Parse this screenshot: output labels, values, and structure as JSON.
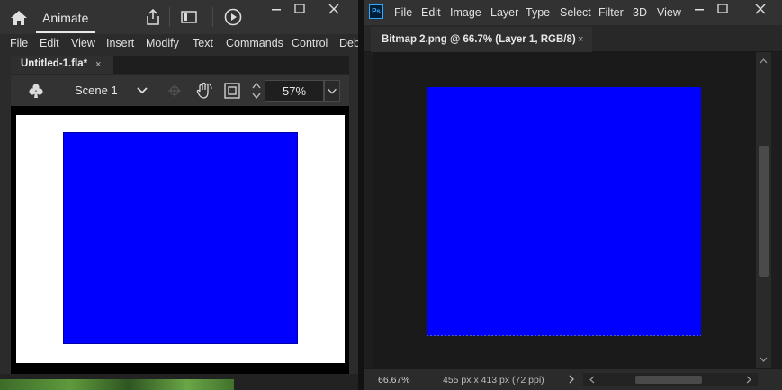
{
  "animate": {
    "app_title": "Animate",
    "icons": {
      "home": "home-icon",
      "share": "share-icon",
      "layout": "workspace-layout-icon",
      "play": "play-icon",
      "club": "club-icon",
      "chevron": "chevron-down-icon",
      "crosshair": "crosshair-icon",
      "hand": "hand-rotate-icon",
      "fit": "fit-frame-icon",
      "stepper": "stepper-icon"
    },
    "menu": [
      "File",
      "Edit",
      "View",
      "Insert",
      "Modify",
      "Text",
      "Commands",
      "Control",
      "Deb"
    ],
    "doc_tab": {
      "label": "Untitled-1.fla*",
      "close": "×"
    },
    "toolbar": {
      "scene_label": "Scene 1",
      "zoom_value": "57%"
    },
    "colors": {
      "stage_fill": "#0000FF",
      "rect_stroke": "#0000AA",
      "canvas": "#FFFFFF"
    }
  },
  "photoshop": {
    "logo": "Ps",
    "menu": [
      "File",
      "Edit",
      "Image",
      "Layer",
      "Type",
      "Select",
      "Filter",
      "3D",
      "View"
    ],
    "doc_tab": {
      "label": "Bitmap 2.png @ 66.7% (Layer 1, RGB/8)",
      "close": "×"
    },
    "status": {
      "zoom": "66.67%",
      "doc_info": "455 px x 413 px (72 ppi)"
    },
    "colors": {
      "image_fill": "#0000FF"
    }
  },
  "window_controls": {
    "minimize": "minimize-icon",
    "maximize": "maximize-icon",
    "close": "close-icon"
  }
}
